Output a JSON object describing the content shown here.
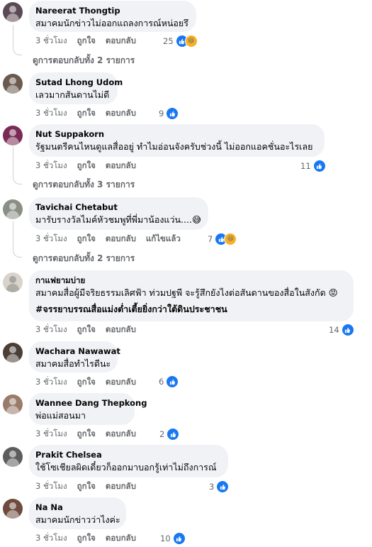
{
  "labels": {
    "time": "3 ชั่วโมง",
    "like": "ถูกใจ",
    "reply": "ตอบกลับ",
    "edited": "แก้ไขแล้ว"
  },
  "comments": [
    {
      "author": "Nareerat Thongtip",
      "lines": [
        "สมาคมนักข่าวไม่ออกแถลงการณ์หน่อยรึ"
      ],
      "reactions": "25",
      "reaction_types": [
        "like",
        "haha"
      ],
      "replies": "ดูการตอบกลับทั้ง 2 รายการ",
      "avatar_color": "#5b4a55"
    },
    {
      "author": "Sutad Lhong Udom",
      "lines": [
        "เลวมากสันดานไม่ดี"
      ],
      "reactions": "9",
      "reaction_types": [
        "like"
      ],
      "avatar_color": "#6b5a4e"
    },
    {
      "author": "Nut Suppakorn",
      "lines": [
        "รัฐมนตรีคนไหนดูแลสื่ออยู่ ทำไมอ่อนจังครับช่วงนี้ ไม่ออกแอคชั่นอะไรเลย"
      ],
      "reactions": "11",
      "reaction_types": [
        "like"
      ],
      "replies": "ดูการตอบกลับทั้ง 3 รายการ",
      "avatar_color": "#7a2b55"
    },
    {
      "author": "Tavichai Chetabut",
      "lines": [
        "มารับรางวัลไมค์หัวชมพูที่พี่มาน้องแว่น....😅"
      ],
      "reactions": "7",
      "reaction_types": [
        "like",
        "haha"
      ],
      "edited": true,
      "replies": "ดูการตอบกลับทั้ง 2 รายการ",
      "avatar_color": "#8a8f86"
    },
    {
      "author": "กาแฟยามบ่าย",
      "lines": [
        "สมาคมสื่อผู้มีจริยธรรมเลิศฟ้า ท่วมปฐพี จะรู้สึกยังไงต่อสันดานของสื่อในสังกัด 😡"
      ],
      "hashtag": "#จรรยาบรรณสื่อแม่งต่ำเตี้ยยิ่งกว่าใต้ดินประชาชน",
      "reactions": "14",
      "reaction_types": [
        "like"
      ],
      "avatar_color": "#d8d4cc"
    },
    {
      "author": "Wachara Nawawat",
      "lines": [
        "สมาคมสื่อทำไรดีนะ"
      ],
      "reactions": "6",
      "reaction_types": [
        "like"
      ],
      "avatar_color": "#4a3f36"
    },
    {
      "author": "Wannee Dang Thepkong",
      "lines": [
        "พ่อแม่สอนมา"
      ],
      "reactions": "2",
      "reaction_types": [
        "like"
      ],
      "avatar_color": "#9a7b6a"
    },
    {
      "author": "Prakit Chelsea",
      "lines": [
        "ใช้โซเชียลผิดเดี๋ยวก็ออกมาบอกรู้เท่าไม่ถึงการณ์"
      ],
      "reactions": "3",
      "reaction_types": [
        "like"
      ],
      "avatar_color": "#5d5d5d"
    },
    {
      "author": "Na Na",
      "lines": [
        "สมาคมนักข่าวว่าไงค่ะ"
      ],
      "reactions": "10",
      "reaction_types": [
        "like"
      ],
      "avatar_color": "#6e4b3c"
    }
  ]
}
